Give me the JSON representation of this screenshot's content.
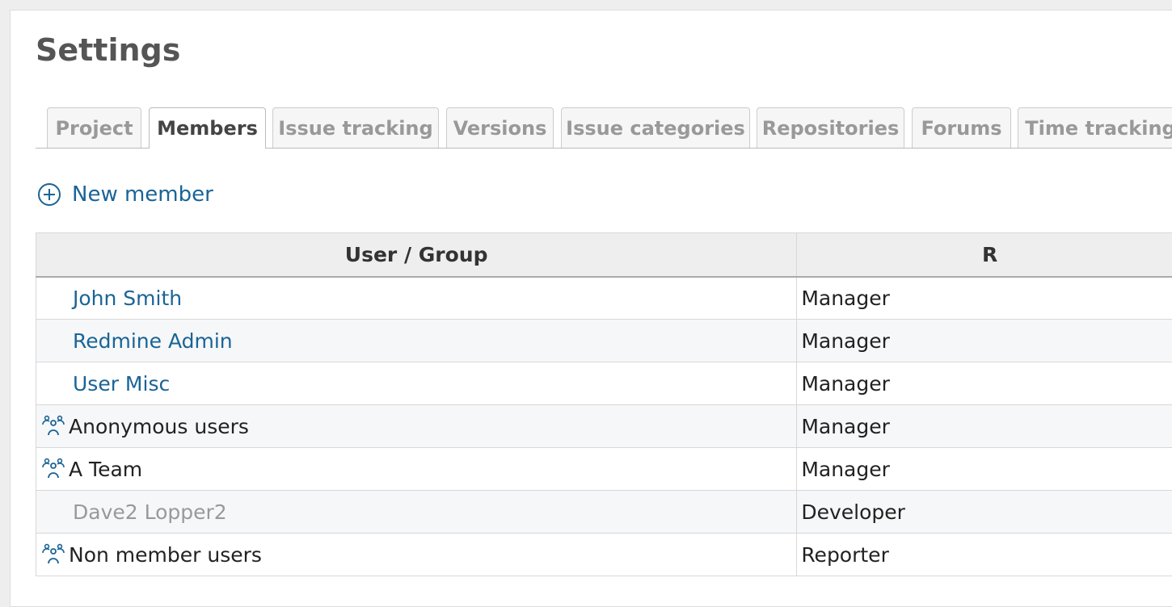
{
  "page": {
    "title": "Settings"
  },
  "tabs": [
    {
      "label": "Project"
    },
    {
      "label": "Members"
    },
    {
      "label": "Issue tracking"
    },
    {
      "label": "Versions"
    },
    {
      "label": "Issue categories"
    },
    {
      "label": "Repositories"
    },
    {
      "label": "Forums"
    },
    {
      "label": "Time tracking"
    }
  ],
  "actions": {
    "new_member": "New member"
  },
  "table": {
    "columns": [
      "User / Group",
      "R"
    ],
    "rows": [
      {
        "name": "John Smith",
        "type": "user",
        "role": "Manager"
      },
      {
        "name": "Redmine Admin",
        "type": "user",
        "role": "Manager"
      },
      {
        "name": "User Misc",
        "type": "user",
        "role": "Manager"
      },
      {
        "name": "Anonymous users",
        "type": "group",
        "role": "Manager"
      },
      {
        "name": "A Team",
        "type": "group",
        "role": "Manager"
      },
      {
        "name": "Dave2 Lopper2",
        "type": "locked-user",
        "role": "Developer"
      },
      {
        "name": "Non member users",
        "type": "group",
        "role": "Reporter"
      }
    ]
  },
  "icons": {
    "new_member": "add-circle-icon",
    "group": "group-icon"
  },
  "colors": {
    "link": "#1a6496",
    "locked": "#999999",
    "active_tab": "#444444",
    "inactive_tab": "#999999"
  }
}
